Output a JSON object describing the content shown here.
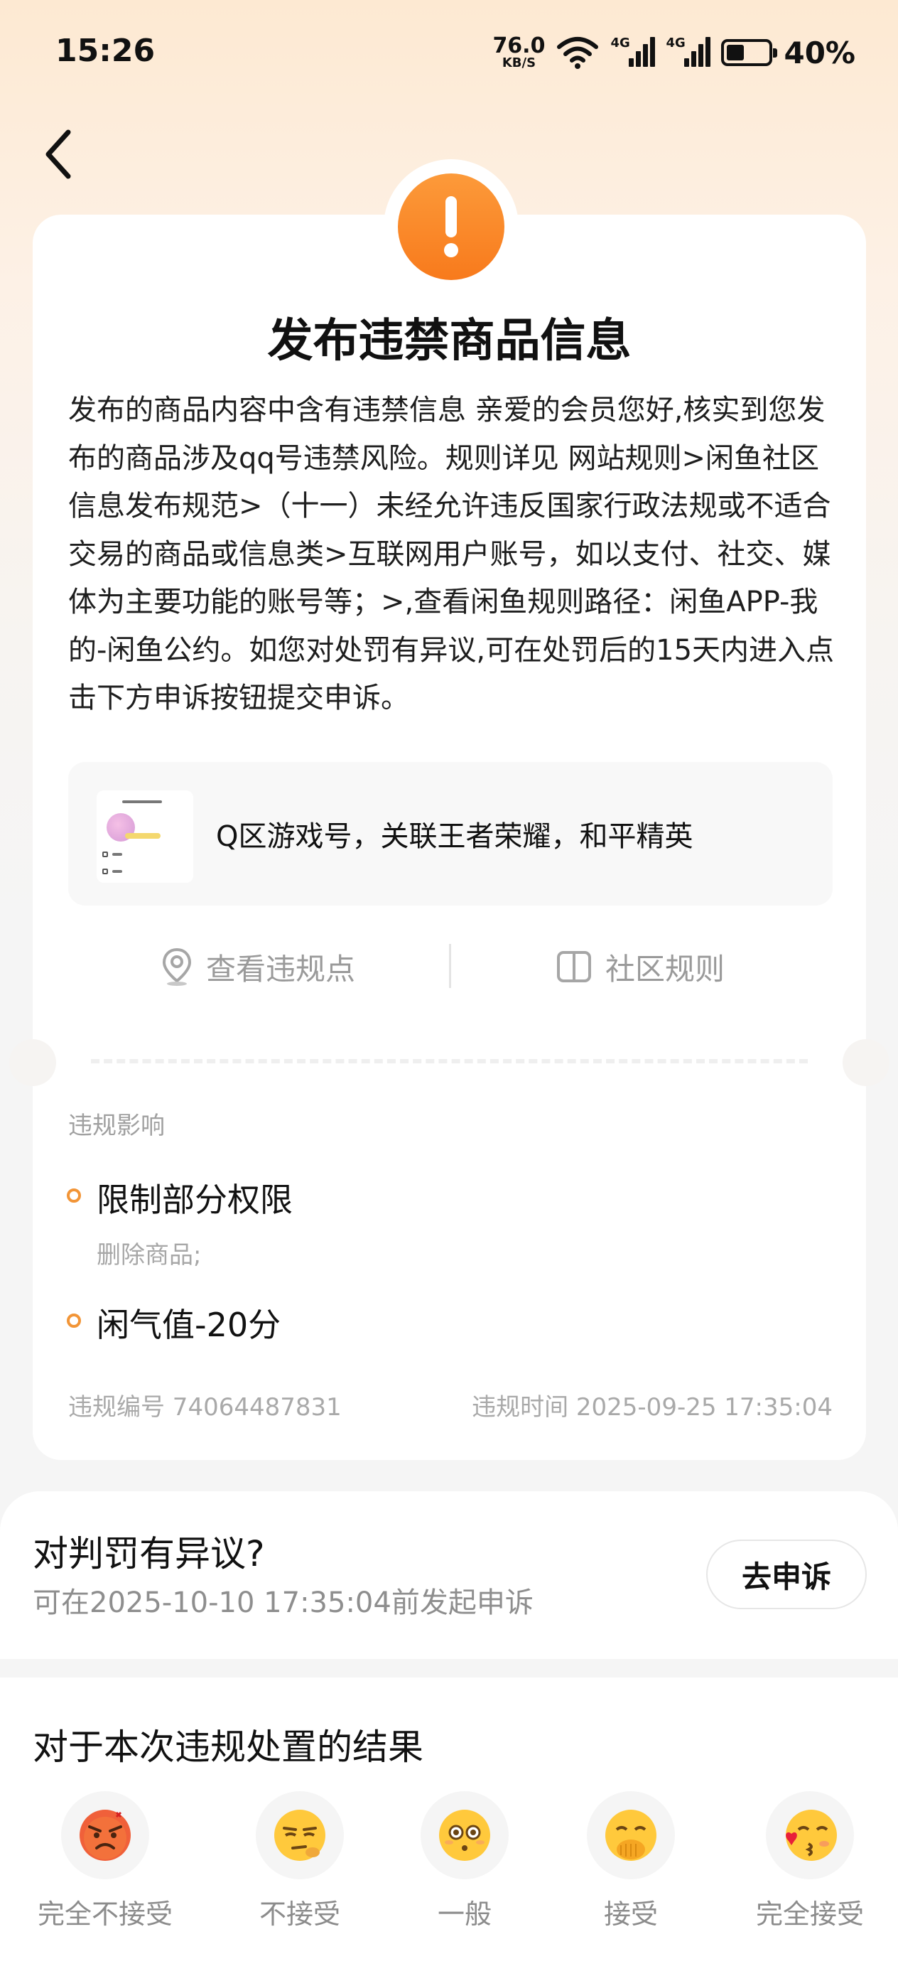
{
  "status_bar": {
    "time": "15:26",
    "net_speed_value": "76.0",
    "net_speed_unit": "KB/S",
    "signal1_label": "4G",
    "signal2_label": "4G",
    "battery_percent": "40%"
  },
  "notice": {
    "title": "发布违禁商品信息",
    "description": "发布的商品内容中含有违禁信息 亲爱的会员您好,核实到您发布的商品涉及qq号违禁风险。规则详见 网站规则>闲鱼社区信息发布规范>（十一）未经允许违反国家行政法规或不适合交易的商品或信息类>互联网用户账号，如以支付、社交、媒体为主要功能的账号等；>,查看闲鱼规则路径：闲鱼APP-我的-闲鱼公约。如您对处罚有异议,可在处罚后的15天内进入点击下方申诉按钮提交申诉。",
    "product_title": "Q区游戏号，关联王者荣耀，和平精英",
    "action_view_points": "查看违规点",
    "action_rules": "社区规则"
  },
  "impact": {
    "label": "违规影响",
    "items": [
      {
        "title": "限制部分权限",
        "sub": "删除商品;"
      },
      {
        "title": "闲气值-20分"
      }
    ],
    "violation_id": "违规编号 74064487831",
    "violation_time": "违规时间 2025-09-25 17:35:04"
  },
  "appeal": {
    "title": "对判罚有异议?",
    "deadline": "可在2025-10-10 17:35:04前发起申诉",
    "button_label": "去申诉"
  },
  "feedback": {
    "title": "对于本次违规处置的结果",
    "options": [
      {
        "label": "完全不接受",
        "icon": "angry-face-icon"
      },
      {
        "label": "不接受",
        "icon": "unamused-face-icon"
      },
      {
        "label": "一般",
        "icon": "neutral-face-icon"
      },
      {
        "label": "接受",
        "icon": "hand-over-mouth-face-icon"
      },
      {
        "label": "完全接受",
        "icon": "kissing-face-icon"
      }
    ]
  },
  "colors": {
    "accent_orange": "#f87a1c",
    "bullet_orange": "#f29537",
    "header_gradient_top": "#fde9d2"
  }
}
